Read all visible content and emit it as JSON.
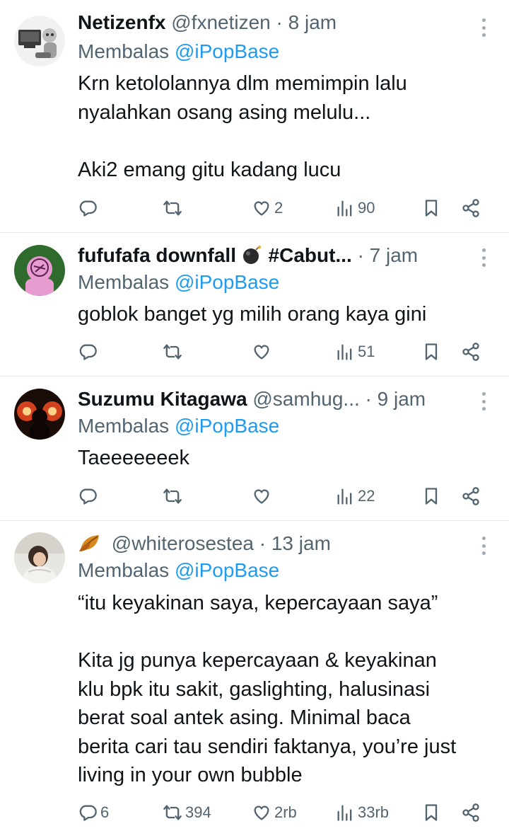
{
  "colors": {
    "accent": "#1d9bf0",
    "muted": "#536471",
    "text": "#0f1419",
    "divider": "#e6e9ec"
  },
  "tweets": [
    {
      "name": "Netizenfx",
      "handle": "@fxnetizen",
      "time": "· 8 jam",
      "reply_label": "Membalas",
      "reply_handle": "@iPopBase",
      "lines": [
        "Krn ketololannya dlm memimpin lalu",
        "nyalahkan osang asing melulu...",
        "",
        "Aki2 emang gitu kadang lucu"
      ],
      "replies": "",
      "retweets": "",
      "likes": "2",
      "views": "90"
    },
    {
      "name": "fufufafa downfall",
      "name_suffix": "#Cabut...",
      "time": "· 7 jam",
      "reply_label": "Membalas",
      "reply_handle": "@iPopBase",
      "lines": [
        "goblok banget yg milih orang kaya gini"
      ],
      "replies": "",
      "retweets": "",
      "likes": "",
      "views": "51"
    },
    {
      "name": "Suzumu Kitagawa",
      "handle": "@samhug...",
      "time": "· 9 jam",
      "reply_label": "Membalas",
      "reply_handle": "@iPopBase",
      "lines": [
        "Taeeeeeeek"
      ],
      "replies": "",
      "retweets": "",
      "likes": "",
      "views": "22"
    },
    {
      "handle": "@whiterosestea",
      "time": "· 13 jam",
      "reply_label": "Membalas",
      "reply_handle": "@iPopBase",
      "lines": [
        "“itu keyakinan saya, kepercayaan saya”",
        "",
        "Kita jg punya kepercayaan & keyakinan",
        "klu bpk itu sakit, gaslighting, halusinasi",
        "berat soal antek asing. Minimal baca",
        "berita cari tau sendiri faktanya, you’re just",
        "living in your own bubble"
      ],
      "replies": "6",
      "retweets": "394",
      "likes": "2rb",
      "views": "33rb"
    }
  ],
  "icons": [
    "reply-icon",
    "retweet-icon",
    "like-icon",
    "views-icon",
    "bookmark-icon",
    "share-icon",
    "more-options-icon",
    "bomb-emoji",
    "leaf-emoji"
  ]
}
